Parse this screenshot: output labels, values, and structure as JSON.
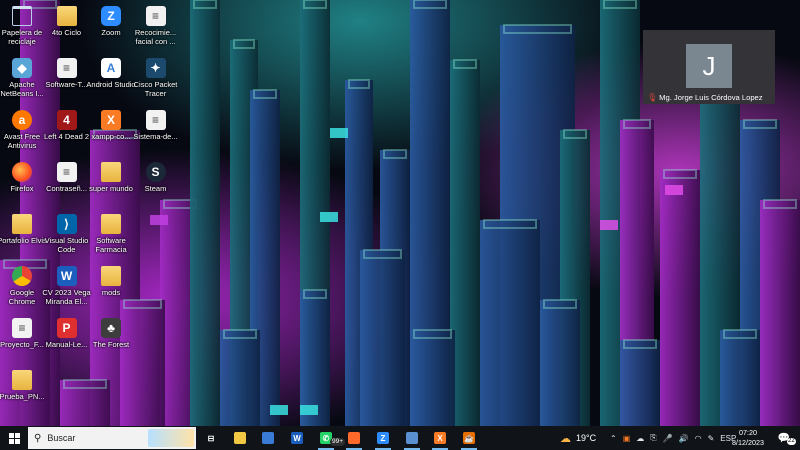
{
  "desktop_icons": [
    {
      "name": "recycle-bin-icon",
      "cls": "recycle",
      "glyph": "",
      "label": "Papelera de reciclaje",
      "col": 0,
      "row": 0
    },
    {
      "name": "folder-icon",
      "cls": "folder",
      "glyph": "",
      "label": "4to Ciclo",
      "col": 1,
      "row": 0
    },
    {
      "name": "zoom-icon",
      "cls": "zoom",
      "glyph": "Z",
      "label": "Zoom",
      "col": 2,
      "row": 0
    },
    {
      "name": "document-icon",
      "cls": "doc",
      "glyph": "≡",
      "label": "Recocimie... facial con ...",
      "col": 3,
      "row": 0
    },
    {
      "name": "netbeans-icon",
      "cls": "netbeans",
      "glyph": "◆",
      "label": "Apache NetBeans I...",
      "col": 0,
      "row": 1
    },
    {
      "name": "document-icon",
      "cls": "doc",
      "glyph": "≡",
      "label": "Software-T...",
      "col": 1,
      "row": 1
    },
    {
      "name": "android-studio-icon",
      "cls": "android",
      "glyph": "A",
      "label": "Android Studio",
      "col": 2,
      "row": 1
    },
    {
      "name": "cisco-packet-tracer-icon",
      "cls": "cisco",
      "glyph": "✦",
      "label": "Cisco Packet Tracer",
      "col": 3,
      "row": 1
    },
    {
      "name": "avast-icon",
      "cls": "avast",
      "glyph": "a",
      "label": "Avast Free Antivirus",
      "col": 0,
      "row": 2
    },
    {
      "name": "left-4-dead-icon",
      "cls": "l4d",
      "glyph": "4",
      "label": "Left 4 Dead 2",
      "col": 1,
      "row": 2
    },
    {
      "name": "xampp-icon",
      "cls": "xampp",
      "glyph": "X",
      "label": "xampp-co...",
      "col": 2,
      "row": 2
    },
    {
      "name": "document-icon",
      "cls": "doc",
      "glyph": "≡",
      "label": "Sistema-de...",
      "col": 3,
      "row": 2
    },
    {
      "name": "firefox-icon",
      "cls": "firefox",
      "glyph": "",
      "label": "Firefox",
      "col": 0,
      "row": 3
    },
    {
      "name": "document-icon",
      "cls": "doc",
      "glyph": "≡",
      "label": "Contraseñ...",
      "col": 1,
      "row": 3
    },
    {
      "name": "folder-icon",
      "cls": "folder",
      "glyph": "",
      "label": "super mundo",
      "col": 2,
      "row": 3
    },
    {
      "name": "steam-icon",
      "cls": "steam",
      "glyph": "S",
      "label": "Steam",
      "col": 3,
      "row": 3
    },
    {
      "name": "folder-icon",
      "cls": "folder",
      "glyph": "",
      "label": "Portafolio Elvis",
      "col": 0,
      "row": 4
    },
    {
      "name": "vscode-icon",
      "cls": "vscode",
      "glyph": "⟩",
      "label": "Visual Studio Code",
      "col": 1,
      "row": 4
    },
    {
      "name": "folder-icon",
      "cls": "folder",
      "glyph": "",
      "label": "Software Farmacia",
      "col": 2,
      "row": 4
    },
    {
      "name": "chrome-icon",
      "cls": "chrome",
      "glyph": "",
      "label": "Google Chrome",
      "col": 0,
      "row": 5
    },
    {
      "name": "word-doc-icon",
      "cls": "word",
      "glyph": "W",
      "label": "CV 2023 Vega Miranda El...",
      "col": 1,
      "row": 5
    },
    {
      "name": "folder-icon",
      "cls": "folder",
      "glyph": "",
      "label": "mods",
      "col": 2,
      "row": 5
    },
    {
      "name": "document-icon",
      "cls": "doc",
      "glyph": "≡",
      "label": "Proyecto_F...",
      "col": 0,
      "row": 6
    },
    {
      "name": "pdf-icon",
      "cls": "pdf",
      "glyph": "P",
      "label": "Manual-Le...",
      "col": 1,
      "row": 6
    },
    {
      "name": "the-forest-icon",
      "cls": "forest",
      "glyph": "♣",
      "label": "The Forest",
      "col": 2,
      "row": 6
    },
    {
      "name": "folder-icon",
      "cls": "folder",
      "glyph": "",
      "label": "Prueba_PN...",
      "col": 0,
      "row": 7
    }
  ],
  "meeting": {
    "avatar_letter": "J",
    "participant": "Mg. Jorge Luis Córdova Lopez"
  },
  "taskbar": {
    "search_placeholder": "Buscar",
    "whatsapp_badge": "99+",
    "pinned": [
      {
        "name": "task-view-icon",
        "glyph": "⊟",
        "color": "transparent"
      },
      {
        "name": "file-explorer-icon",
        "glyph": "",
        "color": "#f2c744"
      },
      {
        "name": "microsoft-store-icon",
        "glyph": "",
        "color": "#3a7bd5"
      },
      {
        "name": "word-icon",
        "glyph": "W",
        "color": "#1b5ebe"
      },
      {
        "name": "whatsapp-icon",
        "glyph": "✆",
        "color": "#25d366"
      },
      {
        "name": "firefox-icon",
        "glyph": "",
        "color": "#ff6a2b"
      },
      {
        "name": "zoom-icon",
        "glyph": "Z",
        "color": "#2d8cff"
      },
      {
        "name": "virtualbox-icon",
        "glyph": "",
        "color": "#5a8fd0"
      },
      {
        "name": "xampp-icon",
        "glyph": "X",
        "color": "#fb7a24"
      },
      {
        "name": "java-icon",
        "glyph": "☕",
        "color": "#e76f00"
      }
    ],
    "weather_temp": "19°C",
    "language": "ESP",
    "time": "07:20",
    "date": "8/12/2023",
    "notification_count": "22"
  }
}
